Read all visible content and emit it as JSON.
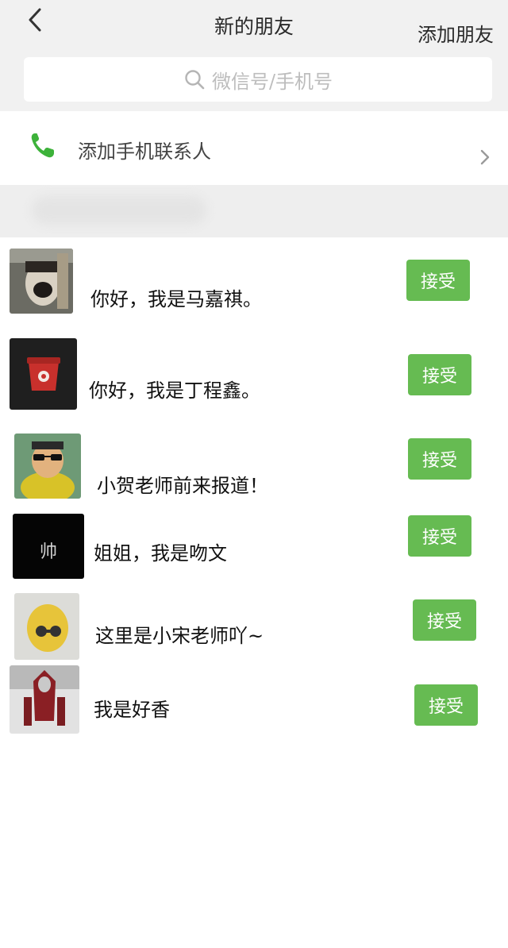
{
  "header": {
    "title": "新的朋友",
    "add_friend": "添加朋友"
  },
  "search": {
    "placeholder": "微信号/手机号"
  },
  "contacts_entry": {
    "label": "添加手机联系人"
  },
  "requests": [
    {
      "message": "你好，我是马嘉祺。",
      "accept_label": "接受"
    },
    {
      "message": "你好，我是丁程鑫。",
      "accept_label": "接受"
    },
    {
      "message": "小贺老师前来报道！",
      "accept_label": "接受"
    },
    {
      "message": "姐姐，我是吻文",
      "accept_label": "接受"
    },
    {
      "message": "这里是小宋老师吖~",
      "accept_label": "接受"
    },
    {
      "message": "我是好香",
      "accept_label": "接受"
    }
  ],
  "avatars": {
    "avatar_4_text": "帅"
  },
  "colors": {
    "accent_green": "#66bb52",
    "phone_green": "#3db23a",
    "header_bg": "#f1f1f1"
  }
}
